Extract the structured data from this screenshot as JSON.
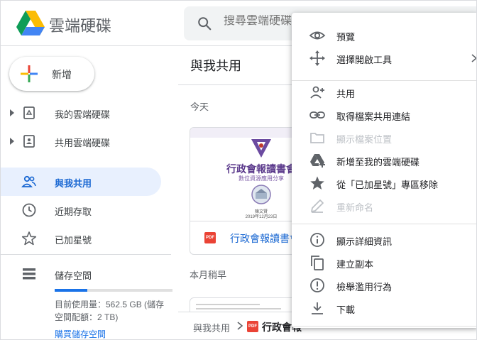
{
  "app": {
    "title": "雲端硬碟"
  },
  "search": {
    "placeholder": "搜尋雲端硬碟"
  },
  "sidebar": {
    "new_label": "新增",
    "items": [
      {
        "label": "我的雲端硬碟",
        "icon": "my-drive-icon"
      },
      {
        "label": "共用雲端硬碟",
        "icon": "shared-drives-icon"
      },
      {
        "label": "與我共用",
        "icon": "shared-with-me-icon",
        "active": true
      },
      {
        "label": "近期存取",
        "icon": "recent-icon"
      },
      {
        "label": "已加星號",
        "icon": "star-icon"
      }
    ],
    "storage": {
      "label": "儲存空間",
      "used_text": "目前使用量：562.5 GB (儲存",
      "quota_text": "空間配額：2 TB)",
      "buy_label": "購買儲存空間",
      "used_fraction": 0.275
    }
  },
  "main": {
    "title": "與我共用",
    "section_today": "今天",
    "section_month": "本月稍早",
    "card": {
      "name": "行政會報讀書會",
      "file_type": "PDF",
      "thumb_title": "行政會報讀書會",
      "thumb_subtitle": "數位資源應用分享",
      "thumb_author": "陳文賢",
      "thumb_date": "2019年12月23日"
    },
    "breadcrumb": {
      "root": "與我共用",
      "file": "行政會報"
    }
  },
  "context_menu": {
    "items": [
      {
        "label": "預覽",
        "icon": "eye-icon"
      },
      {
        "label": "選擇開啟工具",
        "icon": "open-with-icon",
        "submenu": true
      },
      {
        "label": "共用",
        "icon": "person-add-icon"
      },
      {
        "label": "取得檔案共用連結",
        "icon": "link-icon"
      },
      {
        "label": "顯示檔案位置",
        "icon": "folder-icon",
        "disabled": true
      },
      {
        "label": "新增至我的雲端硬碟",
        "icon": "add-to-drive-icon"
      },
      {
        "label": "從「已加星號」專區移除",
        "icon": "star-filled-icon"
      },
      {
        "label": "重新命名",
        "icon": "pencil-icon",
        "disabled": true
      },
      {
        "label": "顯示詳細資訊",
        "icon": "info-icon"
      },
      {
        "label": "建立副本",
        "icon": "copy-icon"
      },
      {
        "label": "檢舉濫用行為",
        "icon": "report-icon"
      },
      {
        "label": "下載",
        "icon": "download-icon"
      }
    ]
  },
  "colors": {
    "accent": "#1a73e8",
    "active_bg": "#e8f0fe",
    "pdf_red": "#ea4335",
    "thumb_purple": "#5b3a8c"
  }
}
